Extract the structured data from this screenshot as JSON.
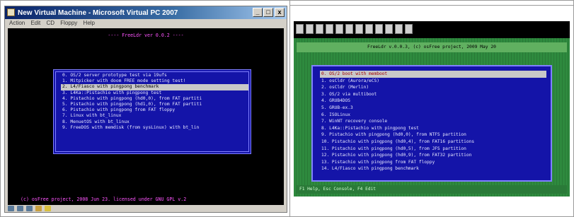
{
  "left": {
    "window_title": "New Virtual Machine - Microsoft Virtual PC 2007",
    "title_buttons": [
      "_",
      "□",
      "x"
    ],
    "menu": [
      "Action",
      "Edit",
      "CD",
      "Floppy",
      "Help"
    ],
    "header": "---- FreeLdr ver 0.0.2 ----",
    "items": [
      "0. OS/2 server prototype test via 19ufs",
      "1. Mitpicker with doom FREE mode setting test!",
      "2. L4/Fiasco with pingpong benchmark",
      "3. L4Ka::Pistachio with pingpong test",
      "4. Pistachio with pingpong (hd0,0), from FAT partiti",
      "5. Pistachio with pingpong (hd1,0), from FAT partiti",
      "6. Pistachio with pingpong from FAT floppy",
      "7. Linux with bt_linux",
      "8. MenuetOS with bt_linux",
      "9. FreeDOS with memdisk (from sysLinux) with bt_lin"
    ],
    "selected_index": 2,
    "footer": "(c) osFree project, 2008 Jun 23. licensed under GNU GPL v.2"
  },
  "right": {
    "toolbar_icons": [
      "floppy-icon",
      "floppy-icon",
      "gear-icon",
      "cdrom-icon",
      "cdrom-icon",
      "reset-icon",
      "text-icon",
      "keyboard-icon",
      "network-icon",
      "screen-icon",
      "fullscreen-icon",
      "settings-icon"
    ],
    "header": "FreeLdr v.0.0.3, (c) osFree project, 2009 May 20",
    "items": [
      "0. OS/2 boot with memboot",
      "1. osCldr (Aurora/eCS)",
      "2. osCldr (Merlin)",
      "3. OS/2 via multiboot",
      "4. GRUB4DOS",
      "5. GRUB-ex.3",
      "6. ISOLinux",
      "7. WinNT recovery console",
      "8. L4Ka::Pistachio with pingpong test",
      "9. Pistachio with pingpong (hd0,0), from NTFS partition",
      "10. Pistachio with pingpong (hd0,4), from FAT16 partitions",
      "11. Pistachio with pingpong (hd0,5), from JFS partition",
      "12. Pistachio with pingpong (hd0,9), from FAT32 partition",
      "13. Pistachio with pingpong from FAT floppy",
      "14. L4/Fiasco with pingpong benchmark"
    ],
    "selected_index": 0,
    "footer": "F1 Help, Esc Console, F4 Edit"
  }
}
